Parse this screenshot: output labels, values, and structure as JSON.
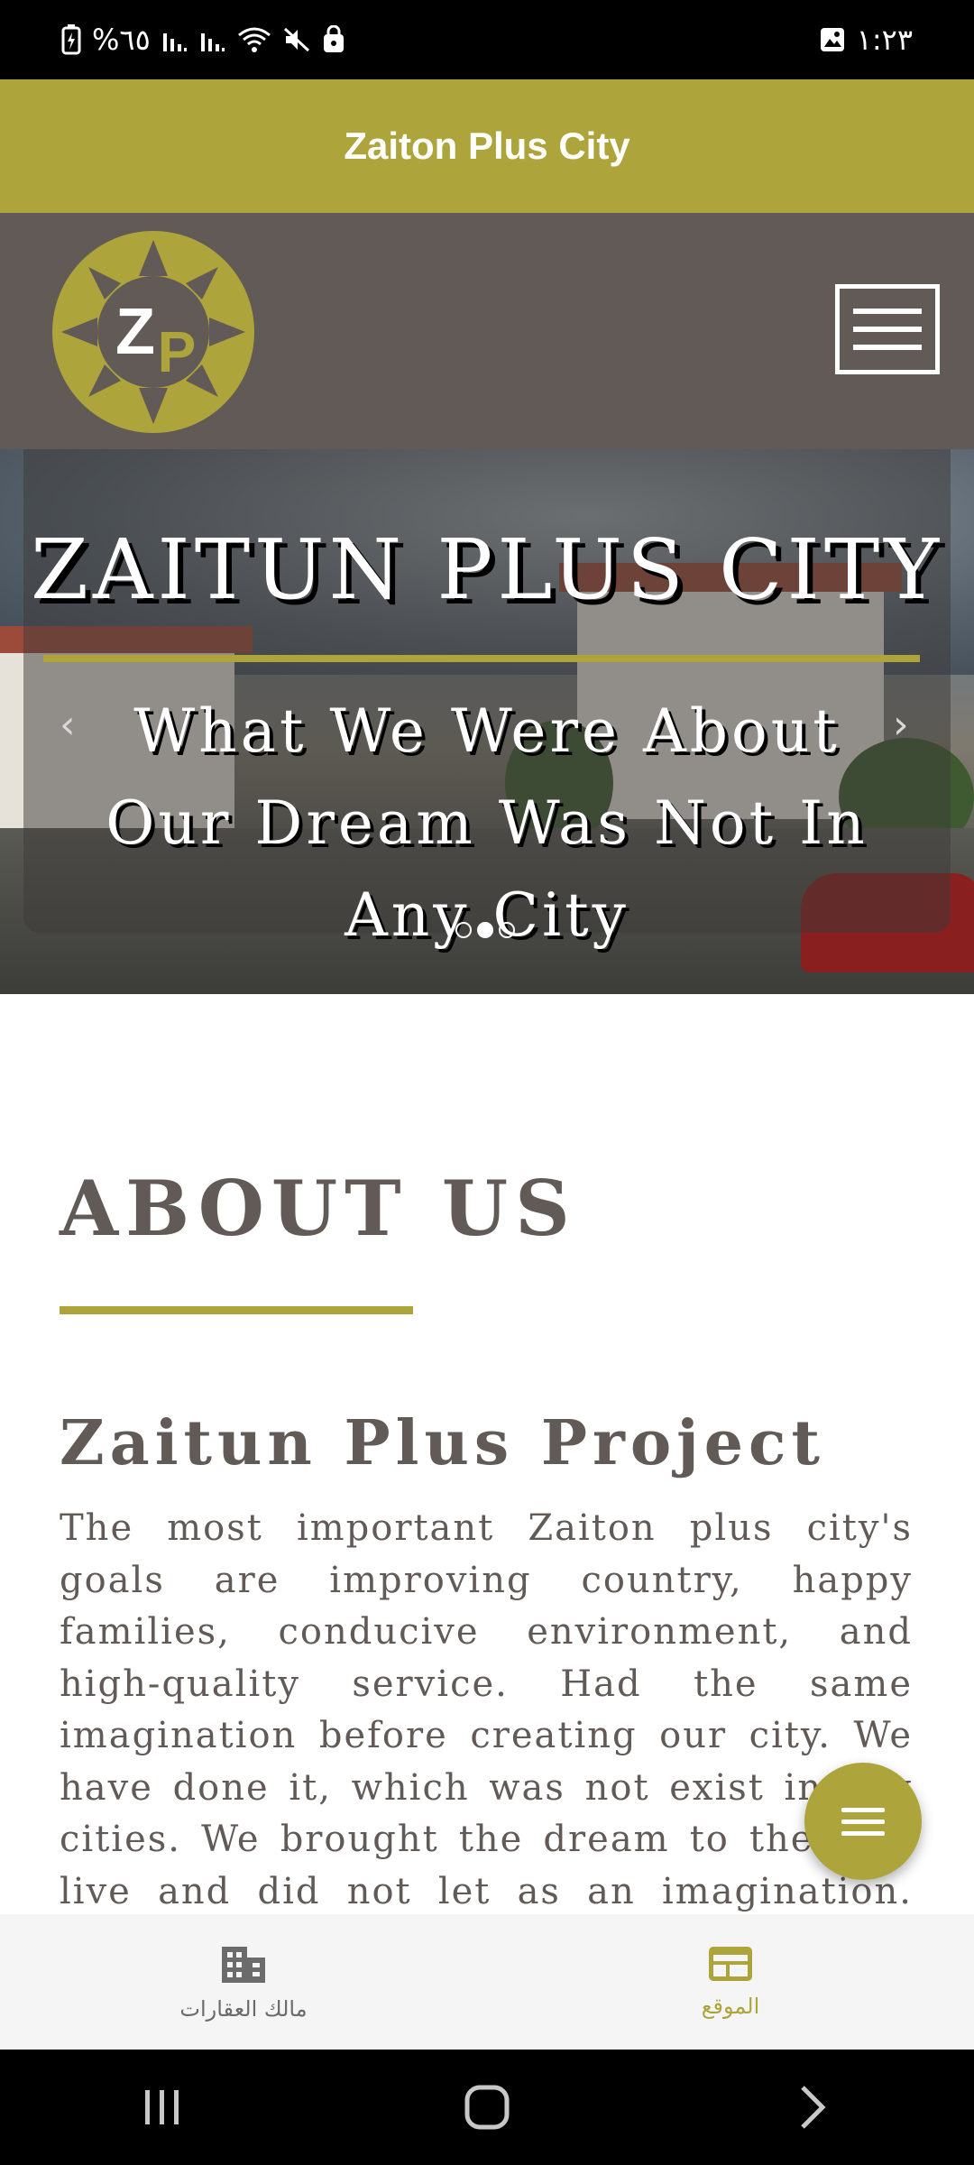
{
  "status_bar": {
    "battery_text": "%٦٥",
    "time": "١:٢٣"
  },
  "app_bar": {
    "title": "Zaiton Plus City"
  },
  "hero": {
    "title": "ZAITUN PLUS CITY",
    "subtitle": "What We Were About Our Dream Was Not In Any City",
    "slides_total": 3,
    "active_slide": 2
  },
  "about": {
    "heading": "ABOUT US",
    "project_title": "Zaitun Plus Project",
    "text": "The most important Zaiton plus city's goals are improving country, happy families, conducive environment, and high-quality service. Had the same imagination before creating our city. We have done it, which was not exist in any cities. We brought the dream to the real live and did not let as an imagination. Now"
  },
  "bottom_nav": {
    "items": [
      {
        "label": "مالك العقارات",
        "icon": "building-icon",
        "active": false
      },
      {
        "label": "الموقع",
        "icon": "web-icon",
        "active": true
      }
    ]
  },
  "colors": {
    "brand_olive": "#ada43c",
    "brand_gray": "#625a56"
  }
}
